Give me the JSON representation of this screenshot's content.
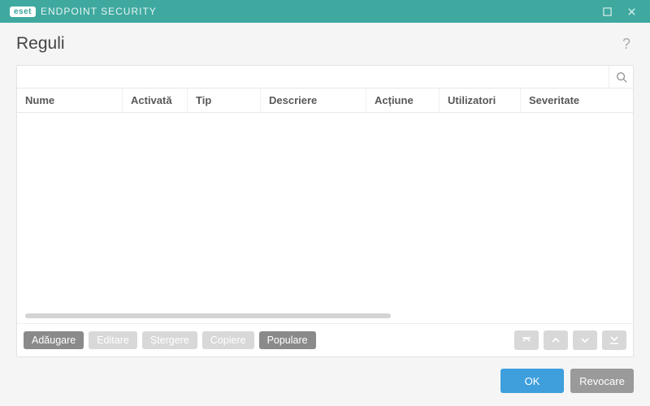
{
  "brand": {
    "badge": "eset",
    "product": "ENDPOINT SECURITY"
  },
  "page": {
    "title": "Reguli"
  },
  "search": {
    "value": "",
    "placeholder": ""
  },
  "columns": {
    "nume": "Nume",
    "activata": "Activată",
    "tip": "Tip",
    "descriere": "Descriere",
    "actiune": "Acțiune",
    "utilizatori": "Utilizatori",
    "severitate": "Severitate"
  },
  "rows": [],
  "actions": {
    "add": "Adăugare",
    "edit": "Editare",
    "delete": "Ștergere",
    "copy": "Copiere",
    "populate": "Populare"
  },
  "footer": {
    "ok": "OK",
    "cancel": "Revocare"
  }
}
